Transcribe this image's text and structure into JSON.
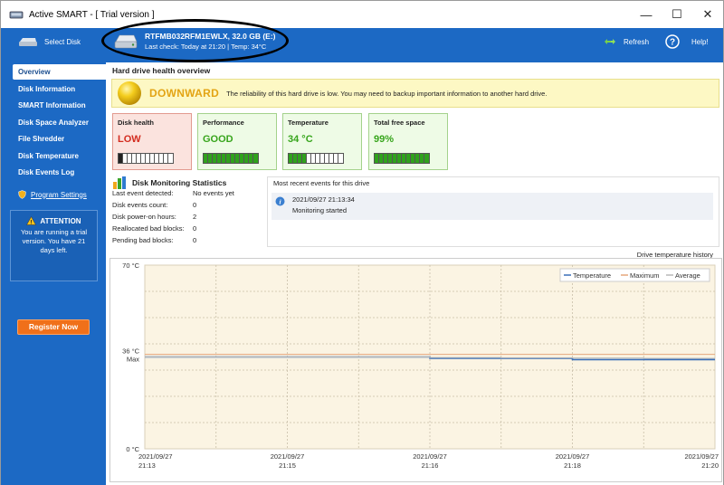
{
  "window": {
    "title": "Active SMART - [ Trial version ]",
    "minimize": "—",
    "maximize": "☐",
    "close": "✕"
  },
  "header": {
    "select_disk": "Select Disk",
    "drive_title": "RTFMB032RFM1EWLX, 32.0 GB (E:)",
    "drive_sub": "Last check: Today at 21:20 | Temp: 34°C",
    "refresh": "Refresh",
    "help": "Help!"
  },
  "sidebar": {
    "items": [
      {
        "label": "Overview",
        "active": true
      },
      {
        "label": "Disk Information"
      },
      {
        "label": "SMART Information"
      },
      {
        "label": "Disk Space Analyzer"
      },
      {
        "label": "File Shredder"
      },
      {
        "label": "Disk Temperature"
      },
      {
        "label": "Disk Events Log"
      }
    ],
    "program_settings": "Program Settings",
    "attention_title": "ATTENTION",
    "attention_text": "You are running a trial version. You have 21 days left.",
    "register": "Register Now"
  },
  "main": {
    "title": "Hard drive health overview",
    "alert_label": "DOWNWARD",
    "alert_msg": "The reliability of this hard drive is low. You may need to backup important information to another hard drive.",
    "cards": [
      {
        "label": "Disk health",
        "value": "LOW",
        "level": 0.1
      },
      {
        "label": "Performance",
        "value": "GOOD",
        "level": 1.0
      },
      {
        "label": "Temperature",
        "value": "34 °C",
        "level": 0.3
      },
      {
        "label": "Total free space",
        "value": "99%",
        "level": 1.0
      }
    ],
    "stats_title": "Disk Monitoring Statistics",
    "stats": [
      {
        "k": "Last event detected:",
        "v": "No events yet"
      },
      {
        "k": "Disk events count:",
        "v": "0"
      },
      {
        "k": "Disk power-on hours:",
        "v": "2"
      },
      {
        "k": "Reallocated bad blocks:",
        "v": "0"
      },
      {
        "k": "Pending bad blocks:",
        "v": "0"
      }
    ],
    "events_title": "Most recent events for this drive",
    "event_time": "2021/09/27 21:13:34",
    "event_msg": "Monitoring started",
    "chart_title": "Drive temperature history"
  },
  "chart_data": {
    "type": "line",
    "title": "Drive temperature history",
    "y_max_label": "70 °C",
    "y_min_label": "0 °C",
    "ylim": [
      0,
      70
    ],
    "max_line_label": "36 °C",
    "max_line_sub": "Max",
    "max_value": 36,
    "legend": [
      "Temperature",
      "Maximum",
      "Average"
    ],
    "legend_position": "top-right",
    "x_ticks": [
      {
        "date": "2021/09/27",
        "time": "21:13"
      },
      {
        "date": "2021/09/27",
        "time": "21:15"
      },
      {
        "date": "2021/09/27",
        "time": "21:16"
      },
      {
        "date": "2021/09/27",
        "time": "21:18"
      },
      {
        "date": "2021/09/27",
        "time": "21:20"
      }
    ],
    "series": [
      {
        "name": "Temperature",
        "values": [
          35,
          35,
          35,
          35,
          34.5,
          34.5,
          34,
          34,
          34
        ]
      },
      {
        "name": "Maximum",
        "values": [
          36,
          36,
          36,
          36,
          36,
          36,
          36,
          36,
          36
        ]
      },
      {
        "name": "Average",
        "values": [
          35,
          35,
          35,
          35,
          34.8,
          34.7,
          34.6,
          34.5,
          34.5
        ]
      }
    ],
    "colors": {
      "temperature": "#3a6fb8",
      "maximum": "#e6a77c",
      "average": "#b8b8b8",
      "plot_bg": "#fbf4e3"
    }
  }
}
